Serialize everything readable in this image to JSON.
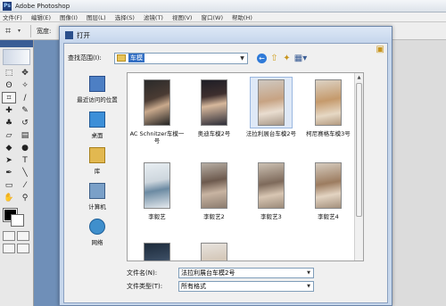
{
  "app": {
    "title": "Adobe Photoshop",
    "logo_text": "Ps"
  },
  "menubar": {
    "items": [
      "文件(F)",
      "编辑(E)",
      "图像(I)",
      "图层(L)",
      "选择(S)",
      "滤镜(T)",
      "视图(V)",
      "窗口(W)",
      "帮助(H)"
    ]
  },
  "options_bar": {
    "width_label": "宽度:"
  },
  "dialog": {
    "title": "打开",
    "look_in_label": "查找范围(I):",
    "look_in_value": "车模",
    "places": [
      {
        "label": "最近访问的位置",
        "icon": "recent-places-icon"
      },
      {
        "label": "桌面",
        "icon": "desktop-icon"
      },
      {
        "label": "库",
        "icon": "library-icon"
      },
      {
        "label": "计算机",
        "icon": "computer-icon"
      },
      {
        "label": "网络",
        "icon": "network-icon"
      }
    ],
    "files": [
      {
        "name": "AC Schnitzer车模一号"
      },
      {
        "name": "奥迪车模2号"
      },
      {
        "name": "法拉利展台车模2号",
        "selected": true
      },
      {
        "name": "柯尼赛格车模3号"
      },
      {
        "name": "李毅艺"
      },
      {
        "name": "李毅艺2"
      },
      {
        "name": "李毅艺3"
      },
      {
        "name": "李毅艺4"
      },
      {
        "name": ""
      },
      {
        "name": ""
      }
    ],
    "filename_label": "文件名(N):",
    "filename_value": "法拉利展台车模2号",
    "filetype_label": "文件类型(T):",
    "filetype_value": "所有格式"
  }
}
